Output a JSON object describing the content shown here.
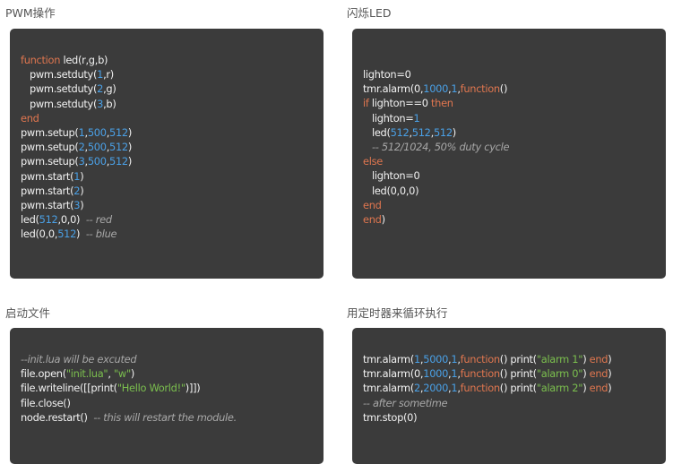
{
  "sections": [
    {
      "title": "PWM操作",
      "lines": [
        [
          [
            "kw",
            "function"
          ],
          [
            "plain",
            " led(r,g,b)"
          ]
        ],
        [
          [
            "plain",
            "   pwm.setduty("
          ],
          [
            "num",
            "1"
          ],
          [
            "plain",
            ",r)"
          ]
        ],
        [
          [
            "plain",
            "   pwm.setduty("
          ],
          [
            "num",
            "2"
          ],
          [
            "plain",
            ",g)"
          ]
        ],
        [
          [
            "plain",
            "   pwm.setduty("
          ],
          [
            "num",
            "3"
          ],
          [
            "plain",
            ",b)"
          ]
        ],
        [
          [
            "kw",
            "end"
          ]
        ],
        [
          [
            "plain",
            "pwm.setup("
          ],
          [
            "num",
            "1"
          ],
          [
            "plain",
            ","
          ],
          [
            "num",
            "500"
          ],
          [
            "plain",
            ","
          ],
          [
            "num",
            "512"
          ],
          [
            "plain",
            ")"
          ]
        ],
        [
          [
            "plain",
            "pwm.setup("
          ],
          [
            "num",
            "2"
          ],
          [
            "plain",
            ","
          ],
          [
            "num",
            "500"
          ],
          [
            "plain",
            ","
          ],
          [
            "num",
            "512"
          ],
          [
            "plain",
            ")"
          ]
        ],
        [
          [
            "plain",
            "pwm.setup("
          ],
          [
            "num",
            "3"
          ],
          [
            "plain",
            ","
          ],
          [
            "num",
            "500"
          ],
          [
            "plain",
            ","
          ],
          [
            "num",
            "512"
          ],
          [
            "plain",
            ")"
          ]
        ],
        [
          [
            "plain",
            "pwm.start("
          ],
          [
            "num",
            "1"
          ],
          [
            "plain",
            ")"
          ]
        ],
        [
          [
            "plain",
            "pwm.start("
          ],
          [
            "num",
            "2"
          ],
          [
            "plain",
            ")"
          ]
        ],
        [
          [
            "plain",
            "pwm.start("
          ],
          [
            "num",
            "3"
          ],
          [
            "plain",
            ")"
          ]
        ],
        [
          [
            "plain",
            "led("
          ],
          [
            "num",
            "512"
          ],
          [
            "plain",
            ",0,0)  "
          ],
          [
            "com",
            "-- red"
          ]
        ],
        [
          [
            "plain",
            "led(0,0,"
          ],
          [
            "num",
            "512"
          ],
          [
            "plain",
            ")  "
          ],
          [
            "com",
            "-- blue"
          ]
        ]
      ]
    },
    {
      "title": "闪烁LED",
      "lines": [
        [
          [
            "plain",
            "lighton=0"
          ]
        ],
        [
          [
            "plain",
            "tmr.alarm(0,"
          ],
          [
            "num",
            "1000"
          ],
          [
            "plain",
            ","
          ],
          [
            "num",
            "1"
          ],
          [
            "plain",
            ","
          ],
          [
            "kw",
            "function"
          ],
          [
            "plain",
            "()"
          ]
        ],
        [
          [
            "kw",
            "if"
          ],
          [
            "plain",
            " lighton==0 "
          ],
          [
            "kw",
            "then"
          ]
        ],
        [
          [
            "plain",
            "   lighton="
          ],
          [
            "num",
            "1"
          ]
        ],
        [
          [
            "plain",
            "   led("
          ],
          [
            "num",
            "512"
          ],
          [
            "plain",
            ","
          ],
          [
            "num",
            "512"
          ],
          [
            "plain",
            ","
          ],
          [
            "num",
            "512"
          ],
          [
            "plain",
            ")"
          ]
        ],
        [
          [
            "plain",
            "   "
          ],
          [
            "com",
            "-- 512/1024, 50% duty cycle"
          ]
        ],
        [
          [
            "kw",
            "else"
          ]
        ],
        [
          [
            "plain",
            "   lighton=0"
          ]
        ],
        [
          [
            "plain",
            "   led(0,0,0)"
          ]
        ],
        [
          [
            "kw",
            "end"
          ]
        ],
        [
          [
            "kw",
            "end"
          ],
          [
            "plain",
            ")"
          ]
        ]
      ]
    },
    {
      "title": "启动文件",
      "lines": [
        [
          [
            "com",
            "--init.lua will be excuted"
          ]
        ],
        [
          [
            "plain",
            "file.open("
          ],
          [
            "str",
            "\"init.lua\""
          ],
          [
            "plain",
            ", "
          ],
          [
            "str",
            "\"w\""
          ],
          [
            "plain",
            ")"
          ]
        ],
        [
          [
            "plain",
            "file.writeline([[print("
          ],
          [
            "str",
            "\"Hello World!\""
          ],
          [
            "plain",
            ")]])"
          ]
        ],
        [
          [
            "plain",
            "file.close()"
          ]
        ],
        [
          [
            "plain",
            "node.restart()  "
          ],
          [
            "com",
            "-- this will restart the module."
          ]
        ]
      ]
    },
    {
      "title": "用定时器来循环执行",
      "lines": [
        [
          [
            "plain",
            "tmr.alarm("
          ],
          [
            "num",
            "1"
          ],
          [
            "plain",
            ","
          ],
          [
            "num",
            "5000"
          ],
          [
            "plain",
            ","
          ],
          [
            "num",
            "1"
          ],
          [
            "plain",
            ","
          ],
          [
            "kw",
            "function"
          ],
          [
            "plain",
            "() print("
          ],
          [
            "str",
            "\"alarm 1\""
          ],
          [
            "plain",
            ") "
          ],
          [
            "kw",
            "end"
          ],
          [
            "plain",
            ")"
          ]
        ],
        [
          [
            "plain",
            "tmr.alarm(0,"
          ],
          [
            "num",
            "1000"
          ],
          [
            "plain",
            ","
          ],
          [
            "num",
            "1"
          ],
          [
            "plain",
            ","
          ],
          [
            "kw",
            "function"
          ],
          [
            "plain",
            "() print("
          ],
          [
            "str",
            "\"alarm 0\""
          ],
          [
            "plain",
            ") "
          ],
          [
            "kw",
            "end"
          ],
          [
            "plain",
            ")"
          ]
        ],
        [
          [
            "plain",
            "tmr.alarm("
          ],
          [
            "num",
            "2"
          ],
          [
            "plain",
            ","
          ],
          [
            "num",
            "2000"
          ],
          [
            "plain",
            ","
          ],
          [
            "num",
            "1"
          ],
          [
            "plain",
            ","
          ],
          [
            "kw",
            "function"
          ],
          [
            "plain",
            "() print("
          ],
          [
            "str",
            "\"alarm 2\""
          ],
          [
            "plain",
            ") "
          ],
          [
            "kw",
            "end"
          ],
          [
            "plain",
            ")"
          ]
        ],
        [
          [
            "com",
            "-- after sometime"
          ]
        ],
        [
          [
            "plain",
            "tmr.stop(0)"
          ]
        ]
      ]
    }
  ]
}
